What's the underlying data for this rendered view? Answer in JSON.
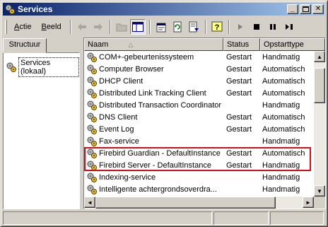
{
  "window": {
    "title": "Services",
    "icon": "services-gear-icon"
  },
  "menu": {
    "actie": "Actie",
    "beeld": "Beeld"
  },
  "toolbar_icons": [
    "back-arrow-icon",
    "forward-arrow-icon",
    "up-folder-icon",
    "show-tree-icon",
    "properties-icon",
    "refresh-icon",
    "export-list-icon",
    "help-icon",
    "start-service-icon",
    "stop-service-icon",
    "pause-service-icon",
    "restart-service-icon"
  ],
  "left_pane": {
    "tab_label": "Structuur",
    "tree_item": "Services (lokaal)"
  },
  "table": {
    "columns": {
      "name": "Naam",
      "status": "Status",
      "startup": "Opstarttype"
    },
    "rows": [
      {
        "name": "COM+-gebeurtenissysteem",
        "status": "Gestart",
        "startup": "Handmatig"
      },
      {
        "name": "Computer Browser",
        "status": "Gestart",
        "startup": "Automatisch"
      },
      {
        "name": "DHCP Client",
        "status": "Gestart",
        "startup": "Automatisch"
      },
      {
        "name": "Distributed Link Tracking Client",
        "status": "Gestart",
        "startup": "Automatisch"
      },
      {
        "name": "Distributed Transaction Coordinator",
        "status": "",
        "startup": "Handmatig"
      },
      {
        "name": "DNS Client",
        "status": "Gestart",
        "startup": "Automatisch"
      },
      {
        "name": "Event Log",
        "status": "Gestart",
        "startup": "Automatisch"
      },
      {
        "name": "Fax-service",
        "status": "",
        "startup": "Handmatig"
      },
      {
        "name": "Firebird Guardian - DefaultInstance",
        "status": "Gestart",
        "startup": "Automatisch"
      },
      {
        "name": "Firebird Server - DefaultInstance",
        "status": "Gestart",
        "startup": "Handmatig"
      },
      {
        "name": "Indexing-service",
        "status": "",
        "startup": "Handmatig"
      },
      {
        "name": "Intelligente achtergrondsoverdra...",
        "status": "",
        "startup": "Handmatig"
      }
    ]
  },
  "colors": {
    "highlight_box": "#d0101e",
    "title_start": "#0a246a",
    "title_end": "#a6caf0"
  }
}
